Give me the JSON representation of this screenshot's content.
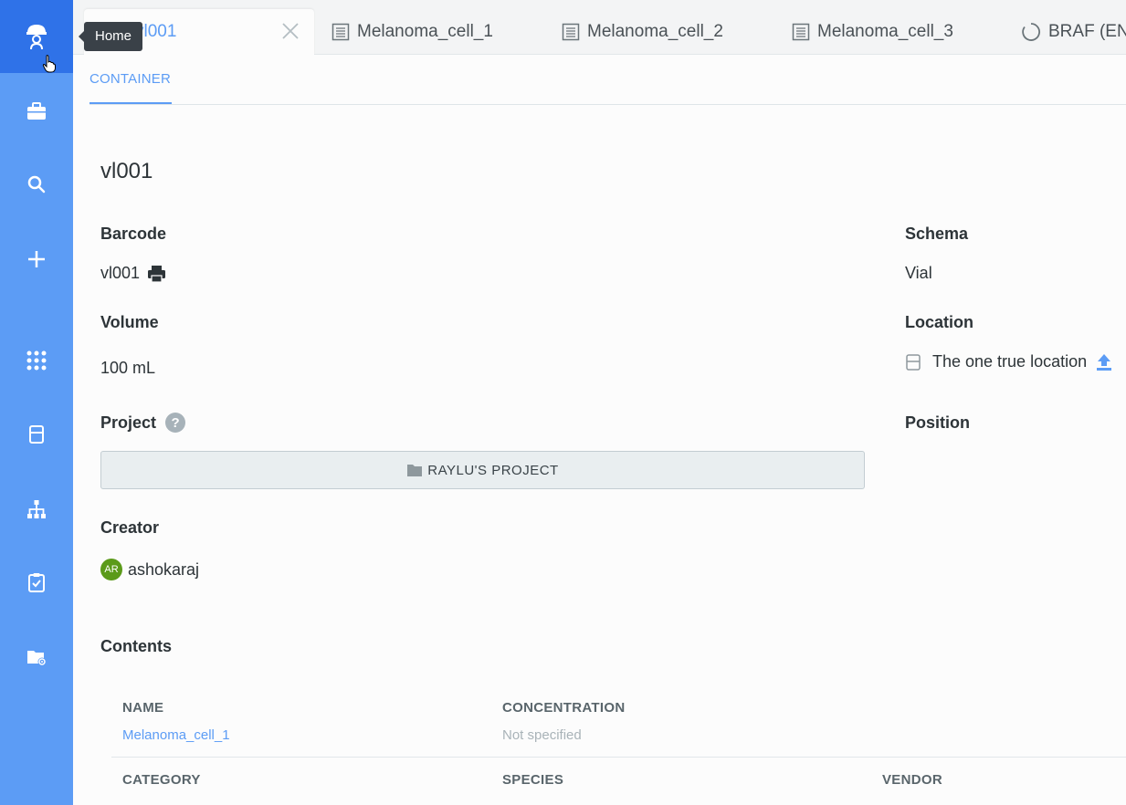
{
  "sidebar": {
    "tooltip": "Home",
    "items": [
      {
        "icon": "briefcase-icon"
      },
      {
        "icon": "search-icon"
      },
      {
        "icon": "plus-icon"
      },
      {
        "icon": "apps-grid-icon"
      },
      {
        "icon": "container-icon"
      },
      {
        "icon": "hierarchy-icon"
      },
      {
        "icon": "clipboard-check-icon"
      },
      {
        "icon": "folder-settings-icon"
      }
    ]
  },
  "tabs": [
    {
      "label": "vl001",
      "active": true
    },
    {
      "label": "Melanoma_cell_1"
    },
    {
      "label": "Melanoma_cell_2"
    },
    {
      "label": "Melanoma_cell_3"
    },
    {
      "label": "BRAF (ENS"
    }
  ],
  "subtab": "CONTAINER",
  "record": {
    "title": "vl001",
    "barcode_label": "Barcode",
    "barcode_value": "vl001",
    "volume_label": "Volume",
    "volume_value": "100 mL",
    "project_label": "Project",
    "project_help": "?",
    "project_value": "RAYLU'S PROJECT",
    "creator_label": "Creator",
    "creator_initials": "AR",
    "creator_name": "ashokaraj",
    "schema_label": "Schema",
    "schema_value": "Vial",
    "location_label": "Location",
    "location_value": "The one true location",
    "position_label": "Position"
  },
  "contents": {
    "heading": "Contents",
    "headers": [
      "NAME",
      "CONCENTRATION"
    ],
    "row": {
      "name": "Melanoma_cell_1",
      "concentration": "Not specified"
    },
    "headers2": [
      "CATEGORY",
      "SPECIES",
      "VENDOR"
    ]
  },
  "colors": {
    "accent": "#5c9cf5",
    "sidebar": "#5c9cf5",
    "sidebar_active": "#2f72e8"
  }
}
